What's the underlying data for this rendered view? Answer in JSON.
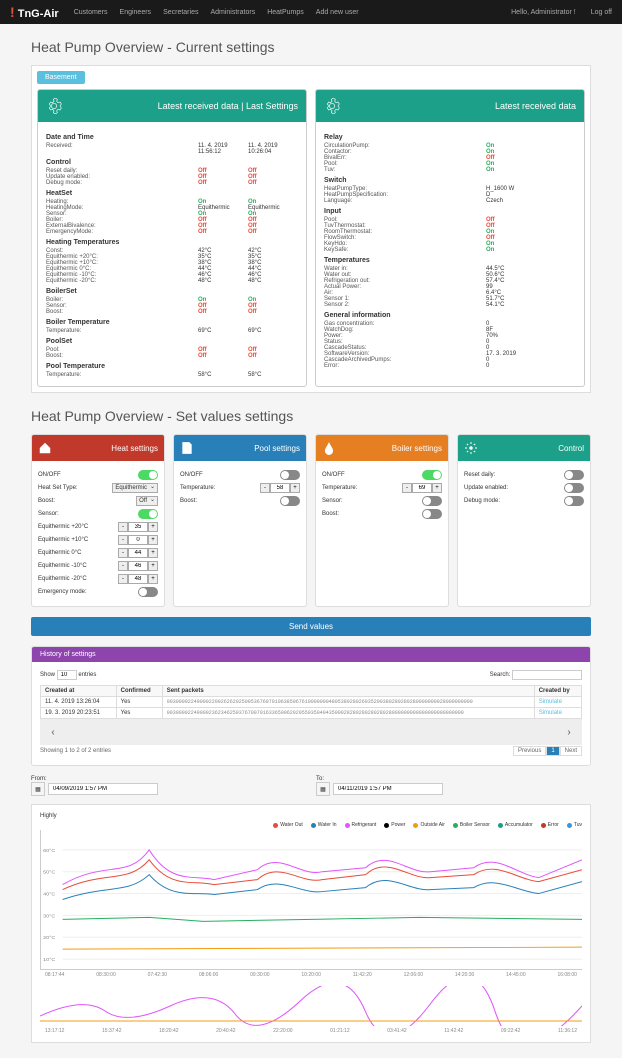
{
  "brand": "TnG-Air",
  "nav": [
    "Customers",
    "Engineers",
    "Secretaries",
    "Administrators",
    "HeatPumps",
    "Add new user"
  ],
  "greeting": "Hello, Administrator !",
  "logoff": "Log off",
  "title1": "Heat Pump Overview - Current settings",
  "tab": "Basement",
  "panel1": {
    "title_a": "Latest received data | Last Settings",
    "datetime": {
      "header": "Date and Time",
      "rows": [
        [
          "Received:",
          "11. 4. 2019",
          "11. 4. 2019"
        ],
        [
          "",
          "11:56:12",
          "10:26:04"
        ]
      ]
    },
    "control": {
      "header": "Control",
      "rows": [
        [
          "Reset daily:",
          "Off",
          "Off",
          "off"
        ],
        [
          "Update enabled:",
          "Off",
          "Off",
          "off"
        ],
        [
          "Debug mode:",
          "Off",
          "Off",
          "off"
        ]
      ]
    },
    "heatset": {
      "header": "HeatSet",
      "rows": [
        [
          "Heating:",
          "On",
          "On",
          "on"
        ],
        [
          "HeatingMode:",
          "Equithermic",
          "Equithermic",
          ""
        ],
        [
          "Sensor:",
          "On",
          "On",
          "on"
        ],
        [
          "Boiler:",
          "Off",
          "Off",
          "off"
        ],
        [
          "ExternalBivalence:",
          "Off",
          "Off",
          "off"
        ],
        [
          "EmergencyMode:",
          "Off",
          "Off",
          "off"
        ]
      ]
    },
    "heatingtemps": {
      "header": "Heating Temperatures",
      "rows": [
        [
          "Const:",
          "42°C",
          "42°C"
        ],
        [
          "Equithermic +20°C:",
          "35°C",
          "35°C"
        ],
        [
          "Equithermic +10°C:",
          "38°C",
          "38°C"
        ],
        [
          "Equithermic 0°C:",
          "44°C",
          "44°C"
        ],
        [
          "Equithermic -10°C:",
          "46°C",
          "46°C"
        ],
        [
          "Equithermic -20°C:",
          "48°C",
          "48°C"
        ]
      ]
    },
    "boilerset": {
      "header": "BoilerSet",
      "rows": [
        [
          "Boiler:",
          "On",
          "On",
          "on"
        ],
        [
          "Sensor:",
          "Off",
          "Off",
          "off"
        ],
        [
          "Boost:",
          "Off",
          "Off",
          "off"
        ]
      ]
    },
    "boilertemp": {
      "header": "Boiler Temperature",
      "rows": [
        [
          "Temperature:",
          "69°C",
          "69°C"
        ]
      ]
    },
    "poolset": {
      "header": "PoolSet",
      "rows": [
        [
          "Pool:",
          "Off",
          "Off",
          "off"
        ],
        [
          "Boost:",
          "Off",
          "Off",
          "off"
        ]
      ]
    },
    "pooltemp": {
      "header": "Pool Temperature",
      "rows": [
        [
          "Temperature:",
          "58°C",
          "58°C"
        ]
      ]
    }
  },
  "panel2": {
    "title": "Latest received data",
    "relay": {
      "header": "Relay",
      "rows": [
        [
          "CirculationPump:",
          "On",
          "on"
        ],
        [
          "Contactor:",
          "On",
          "on"
        ],
        [
          "BivalErr:",
          "Off",
          "off"
        ],
        [
          "Pool:",
          "On",
          "on"
        ],
        [
          "Tuv:",
          "On",
          "on"
        ]
      ]
    },
    "switch": {
      "header": "Switch",
      "rows": [
        [
          "HeatPumpType:",
          "H_1600 W",
          ""
        ],
        [
          "HeatPumpSpecification:",
          "D",
          ""
        ],
        [
          "Language:",
          "Czech",
          ""
        ]
      ]
    },
    "input": {
      "header": "Input",
      "rows": [
        [
          "Pool:",
          "Off",
          "off"
        ],
        [
          "TuvThermostat:",
          "Off",
          "off"
        ],
        [
          "RoomThermostat:",
          "On",
          "on"
        ],
        [
          "FlowSwitch:",
          "Off",
          "off"
        ],
        [
          "KeyHdo:",
          "On",
          "on"
        ],
        [
          "KeySafe:",
          "On",
          "on"
        ]
      ]
    },
    "temps": {
      "header": "Temperatures",
      "rows": [
        [
          "Water in:",
          "44.5°C"
        ],
        [
          "Water out:",
          "50.6°C"
        ],
        [
          "Refrigeration out:",
          "57.4°C"
        ],
        [
          "Actual Power:",
          "99"
        ],
        [
          "Air:",
          "6.4°C"
        ],
        [
          "Sensor 1:",
          "51.7°C"
        ],
        [
          "Sensor 2:",
          "54.1°C"
        ]
      ]
    },
    "general": {
      "header": "General information",
      "rows": [
        [
          "Gas concentration:",
          "0"
        ],
        [
          "WatchDog:",
          "8F"
        ],
        [
          "Power:",
          "70%"
        ],
        [
          "Status:",
          "0"
        ],
        [
          "CascadeStatus:",
          "0"
        ],
        [
          "SoftwareVersion:",
          "17. 3. 2019"
        ],
        [
          "CascadeArchivedPumps:",
          "0"
        ],
        [
          "Error:",
          "0"
        ]
      ]
    }
  },
  "title2": "Heat Pump Overview - Set values settings",
  "heat": {
    "title": "Heat settings",
    "onoff": "ON/OFF",
    "hst": "Heat Set Type:",
    "hst_v": "Equithermic",
    "boost": "Boost:",
    "boost_v": "Off",
    "sensor": "Sensor:",
    "eq": [
      [
        "Equithermic +20°C",
        "35"
      ],
      [
        "Equithermic +10°C",
        "0"
      ],
      [
        "Equithermic 0°C",
        "44"
      ],
      [
        "Equithermic -10°C",
        "46"
      ],
      [
        "Equithermic -20°C",
        "48"
      ]
    ],
    "emerg": "Emergency mode:"
  },
  "pool": {
    "title": "Pool settings",
    "onoff": "ON/OFF",
    "temp": "Temperature:",
    "temp_v": "58",
    "boost": "Boost:"
  },
  "boiler": {
    "title": "Boiler settings",
    "onoff": "ON/OFF",
    "temp": "Temperature:",
    "temp_v": "69",
    "sensor": "Sensor:",
    "boost": "Boost:"
  },
  "ctrl": {
    "title": "Control",
    "reset": "Reset daily:",
    "update": "Update enabled:",
    "debug": "Debug mode:"
  },
  "send": "Send values",
  "history": {
    "title": "History of settings",
    "show": "Show",
    "show_v": "10",
    "entries": "entries",
    "search": "Search:",
    "cols": [
      "Created at",
      "Confirmed",
      "Sent packets",
      "Created by"
    ],
    "rows": [
      [
        "11. 4. 2019 13:26:04",
        "Yes",
        "003000022490002200262620250953676970106385067610000000480538028026035200380280280280000000028000000000",
        "Simulate"
      ],
      [
        "19. 3. 2019 20:23:51",
        "Yes",
        "003000022490002362346250376700701633650062020550350404350002828028028028028000000000000000000000000",
        "Simulate"
      ]
    ],
    "showing": "Showing 1 to 2 of 2 entries",
    "prev": "Previous",
    "next": "Next"
  },
  "from": "From:",
  "to": "To:",
  "from_v": "04/09/2019 1:57 PM",
  "to_v": "04/11/2019 1:57 PM",
  "chart_data": {
    "type": "line",
    "title": "Highly",
    "series": [
      {
        "name": "Water Out",
        "color": "#e74c3c"
      },
      {
        "name": "Water In",
        "color": "#2980b9"
      },
      {
        "name": "Refrigerant",
        "color": "#e056fd"
      },
      {
        "name": "Power",
        "color": "#000"
      },
      {
        "name": "Outside Air",
        "color": "#f39c12"
      },
      {
        "name": "Boiler Sensor",
        "color": "#27ae60"
      },
      {
        "name": "Accumulator",
        "color": "#16a085"
      },
      {
        "name": "Error",
        "color": "#c0392b"
      },
      {
        "name": "Tuv",
        "color": "#3498db"
      }
    ],
    "ylabels": [
      "10°C",
      "20°C",
      "30°C",
      "40°C",
      "50°C",
      "60°C"
    ],
    "xlabels": [
      "08:17:44",
      "08:30:00",
      "07:42:30",
      "08:06:00",
      "09:30:00",
      "10:20:00",
      "11:42:20",
      "12:06:00",
      "14:20:30",
      "14:45:00",
      "16:08:00"
    ],
    "x2labels": [
      "13:17:12",
      "15:37:42",
      "18:20:42",
      "20:40:42",
      "22:20:00",
      "01:21:12",
      "03:41:42",
      "11:42:42",
      "09:22:42",
      "11:36:12"
    ]
  }
}
